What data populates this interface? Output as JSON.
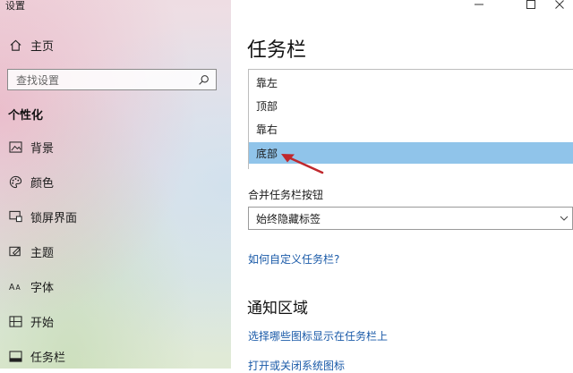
{
  "window": {
    "title": "设置"
  },
  "sidebar": {
    "home_label": "主页",
    "search_placeholder": "查找设置",
    "section": "个性化",
    "items": [
      {
        "label": "背景",
        "icon": "picture-icon"
      },
      {
        "label": "颜色",
        "icon": "palette-icon"
      },
      {
        "label": "锁屏界面",
        "icon": "lock-screen-icon"
      },
      {
        "label": "主题",
        "icon": "theme-icon"
      },
      {
        "label": "字体",
        "icon": "font-icon"
      },
      {
        "label": "开始",
        "icon": "start-icon"
      },
      {
        "label": "任务栏",
        "icon": "taskbar-icon"
      }
    ]
  },
  "main": {
    "title": "任务栏",
    "position_options": [
      {
        "label": "靠左",
        "selected": false
      },
      {
        "label": "顶部",
        "selected": false
      },
      {
        "label": "靠右",
        "selected": false
      },
      {
        "label": "底部",
        "selected": true
      }
    ],
    "combine_label": "合并任务栏按钮",
    "combine_value": "始终隐藏标签",
    "customize_link": "如何自定义任务栏?",
    "notification_title": "通知区域",
    "select_icons_link": "选择哪些图标显示在任务栏上",
    "system_icons_link": "打开或关闭系统图标"
  },
  "colors": {
    "selection": "#90c4ea",
    "link": "#1a5aa8",
    "annotation_arrow": "#c0282d"
  }
}
